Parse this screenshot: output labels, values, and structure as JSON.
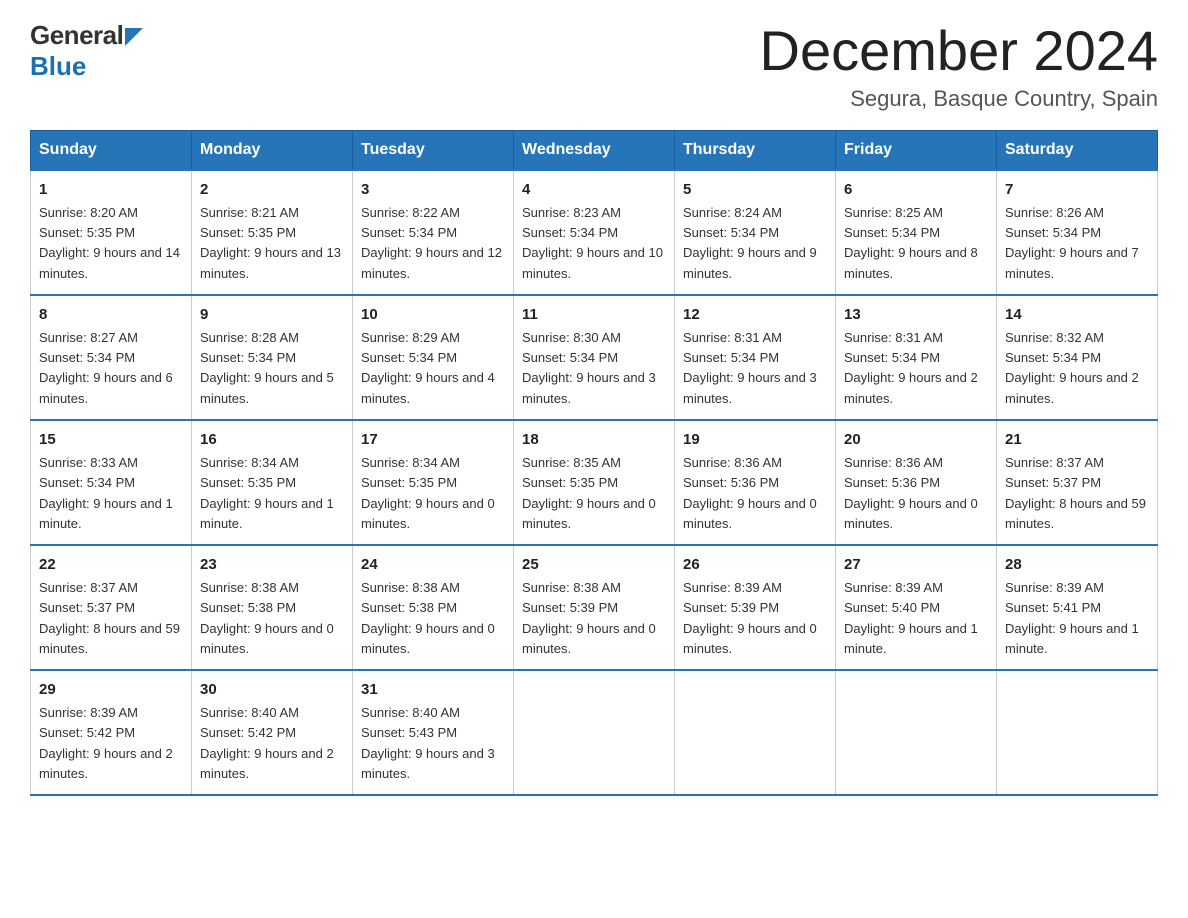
{
  "header": {
    "logo_general": "General",
    "logo_blue": "Blue",
    "month_title": "December 2024",
    "location": "Segura, Basque Country, Spain"
  },
  "days_of_week": [
    "Sunday",
    "Monday",
    "Tuesday",
    "Wednesday",
    "Thursday",
    "Friday",
    "Saturday"
  ],
  "weeks": [
    [
      {
        "day": "1",
        "sunrise": "8:20 AM",
        "sunset": "5:35 PM",
        "daylight": "9 hours and 14 minutes."
      },
      {
        "day": "2",
        "sunrise": "8:21 AM",
        "sunset": "5:35 PM",
        "daylight": "9 hours and 13 minutes."
      },
      {
        "day": "3",
        "sunrise": "8:22 AM",
        "sunset": "5:34 PM",
        "daylight": "9 hours and 12 minutes."
      },
      {
        "day": "4",
        "sunrise": "8:23 AM",
        "sunset": "5:34 PM",
        "daylight": "9 hours and 10 minutes."
      },
      {
        "day": "5",
        "sunrise": "8:24 AM",
        "sunset": "5:34 PM",
        "daylight": "9 hours and 9 minutes."
      },
      {
        "day": "6",
        "sunrise": "8:25 AM",
        "sunset": "5:34 PM",
        "daylight": "9 hours and 8 minutes."
      },
      {
        "day": "7",
        "sunrise": "8:26 AM",
        "sunset": "5:34 PM",
        "daylight": "9 hours and 7 minutes."
      }
    ],
    [
      {
        "day": "8",
        "sunrise": "8:27 AM",
        "sunset": "5:34 PM",
        "daylight": "9 hours and 6 minutes."
      },
      {
        "day": "9",
        "sunrise": "8:28 AM",
        "sunset": "5:34 PM",
        "daylight": "9 hours and 5 minutes."
      },
      {
        "day": "10",
        "sunrise": "8:29 AM",
        "sunset": "5:34 PM",
        "daylight": "9 hours and 4 minutes."
      },
      {
        "day": "11",
        "sunrise": "8:30 AM",
        "sunset": "5:34 PM",
        "daylight": "9 hours and 3 minutes."
      },
      {
        "day": "12",
        "sunrise": "8:31 AM",
        "sunset": "5:34 PM",
        "daylight": "9 hours and 3 minutes."
      },
      {
        "day": "13",
        "sunrise": "8:31 AM",
        "sunset": "5:34 PM",
        "daylight": "9 hours and 2 minutes."
      },
      {
        "day": "14",
        "sunrise": "8:32 AM",
        "sunset": "5:34 PM",
        "daylight": "9 hours and 2 minutes."
      }
    ],
    [
      {
        "day": "15",
        "sunrise": "8:33 AM",
        "sunset": "5:34 PM",
        "daylight": "9 hours and 1 minute."
      },
      {
        "day": "16",
        "sunrise": "8:34 AM",
        "sunset": "5:35 PM",
        "daylight": "9 hours and 1 minute."
      },
      {
        "day": "17",
        "sunrise": "8:34 AM",
        "sunset": "5:35 PM",
        "daylight": "9 hours and 0 minutes."
      },
      {
        "day": "18",
        "sunrise": "8:35 AM",
        "sunset": "5:35 PM",
        "daylight": "9 hours and 0 minutes."
      },
      {
        "day": "19",
        "sunrise": "8:36 AM",
        "sunset": "5:36 PM",
        "daylight": "9 hours and 0 minutes."
      },
      {
        "day": "20",
        "sunrise": "8:36 AM",
        "sunset": "5:36 PM",
        "daylight": "9 hours and 0 minutes."
      },
      {
        "day": "21",
        "sunrise": "8:37 AM",
        "sunset": "5:37 PM",
        "daylight": "8 hours and 59 minutes."
      }
    ],
    [
      {
        "day": "22",
        "sunrise": "8:37 AM",
        "sunset": "5:37 PM",
        "daylight": "8 hours and 59 minutes."
      },
      {
        "day": "23",
        "sunrise": "8:38 AM",
        "sunset": "5:38 PM",
        "daylight": "9 hours and 0 minutes."
      },
      {
        "day": "24",
        "sunrise": "8:38 AM",
        "sunset": "5:38 PM",
        "daylight": "9 hours and 0 minutes."
      },
      {
        "day": "25",
        "sunrise": "8:38 AM",
        "sunset": "5:39 PM",
        "daylight": "9 hours and 0 minutes."
      },
      {
        "day": "26",
        "sunrise": "8:39 AM",
        "sunset": "5:39 PM",
        "daylight": "9 hours and 0 minutes."
      },
      {
        "day": "27",
        "sunrise": "8:39 AM",
        "sunset": "5:40 PM",
        "daylight": "9 hours and 1 minute."
      },
      {
        "day": "28",
        "sunrise": "8:39 AM",
        "sunset": "5:41 PM",
        "daylight": "9 hours and 1 minute."
      }
    ],
    [
      {
        "day": "29",
        "sunrise": "8:39 AM",
        "sunset": "5:42 PM",
        "daylight": "9 hours and 2 minutes."
      },
      {
        "day": "30",
        "sunrise": "8:40 AM",
        "sunset": "5:42 PM",
        "daylight": "9 hours and 2 minutes."
      },
      {
        "day": "31",
        "sunrise": "8:40 AM",
        "sunset": "5:43 PM",
        "daylight": "9 hours and 3 minutes."
      },
      null,
      null,
      null,
      null
    ]
  ]
}
